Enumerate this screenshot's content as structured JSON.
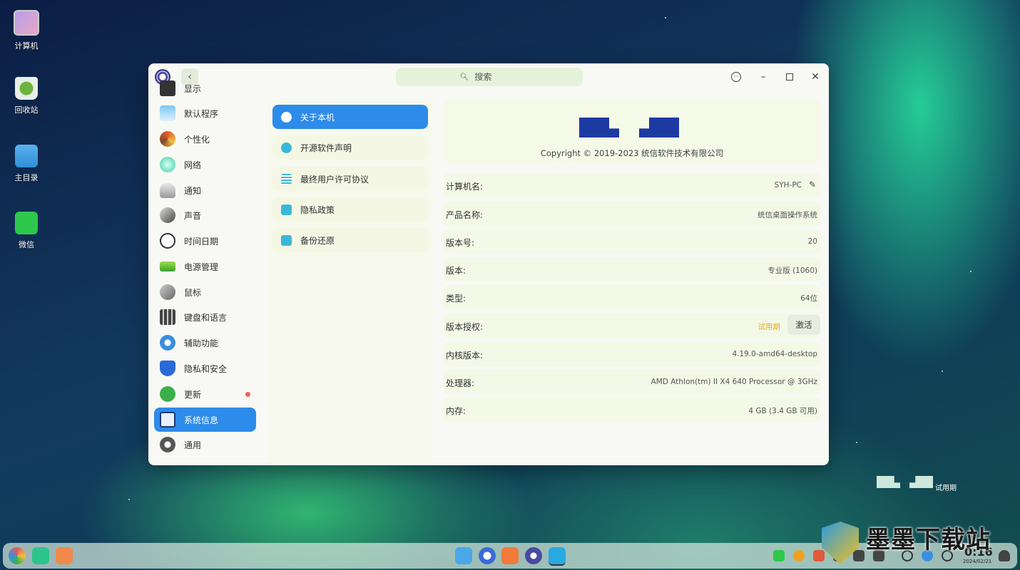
{
  "desktop": {
    "icons": [
      {
        "label": "计算机",
        "icon": "computer-icon"
      },
      {
        "label": "回收站",
        "icon": "trash-icon"
      },
      {
        "label": "主目录",
        "icon": "home-folder-icon"
      },
      {
        "label": "微信",
        "icon": "wechat-icon"
      }
    ],
    "watermark_text": "试用期"
  },
  "window": {
    "search": {
      "placeholder": "搜索",
      "icon": "search-icon"
    },
    "buttons": {
      "menu": "menu-icon",
      "minimize": "minimize-icon",
      "maximize": "maximize-icon",
      "close": "close-icon"
    }
  },
  "sidebar": {
    "items": [
      {
        "label": "显示",
        "icon": "display-icon"
      },
      {
        "label": "默认程序",
        "icon": "default-apps-icon"
      },
      {
        "label": "个性化",
        "icon": "personalization-icon"
      },
      {
        "label": "网络",
        "icon": "network-icon"
      },
      {
        "label": "通知",
        "icon": "notification-bell-icon"
      },
      {
        "label": "声音",
        "icon": "sound-icon"
      },
      {
        "label": "时间日期",
        "icon": "clock-icon"
      },
      {
        "label": "电源管理",
        "icon": "battery-icon"
      },
      {
        "label": "鼠标",
        "icon": "mouse-icon"
      },
      {
        "label": "键盘和语言",
        "icon": "keyboard-icon"
      },
      {
        "label": "辅助功能",
        "icon": "accessibility-icon"
      },
      {
        "label": "隐私和安全",
        "icon": "shield-icon"
      },
      {
        "label": "更新",
        "icon": "update-icon"
      },
      {
        "label": "系统信息",
        "icon": "system-info-icon"
      },
      {
        "label": "通用",
        "icon": "general-icon"
      }
    ],
    "active_index": 13
  },
  "submenu": {
    "items": [
      {
        "label": "关于本机",
        "icon": "info-icon"
      },
      {
        "label": "开源软件声明",
        "icon": "copyright-icon"
      },
      {
        "label": "最终用户许可协议",
        "icon": "document-icon"
      },
      {
        "label": "隐私政策",
        "icon": "privacy-doc-icon"
      },
      {
        "label": "备份还原",
        "icon": "backup-icon"
      }
    ],
    "active_index": 0
  },
  "about": {
    "copyright": "Copyright © 2019-2023 统信软件技术有限公司",
    "rows": [
      {
        "key": "计算机名:",
        "value": "SYH-PC"
      },
      {
        "key": "产品名称:",
        "value": "统信桌面操作系统"
      },
      {
        "key": "版本号:",
        "value": "20"
      },
      {
        "key": "版本:",
        "value": "专业版 (1060)"
      },
      {
        "key": "类型:",
        "value": "64位"
      },
      {
        "key": "版本授权:",
        "value": "试用期",
        "button": "激活"
      },
      {
        "key": "内核版本:",
        "value": "4.19.0-amd64-desktop"
      },
      {
        "key": "处理器:",
        "value": "AMD Athlon(tm) II X4 640 Processor @ 3GHz"
      },
      {
        "key": "内存:",
        "value": "4 GB (3.4 GB 可用)"
      }
    ]
  },
  "taskbar": {
    "clock": "0:16",
    "date": "2024/02/21",
    "site_label": "墨墨下载站"
  },
  "colors": {
    "accent": "#2d8bea",
    "logo": "#1d3aa3",
    "trial": "#e0b020"
  }
}
